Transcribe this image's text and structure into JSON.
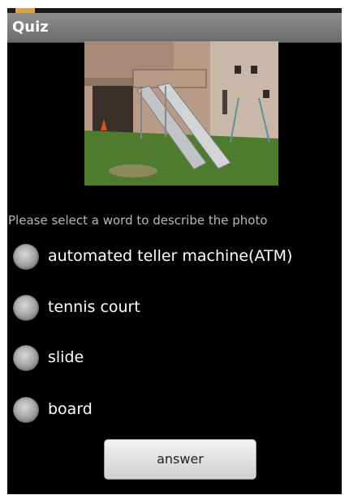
{
  "app": {
    "title": "Quiz"
  },
  "quiz": {
    "prompt": "Please select a word to describe the photo",
    "options": [
      {
        "label": "automated teller machine(ATM)"
      },
      {
        "label": "tennis court"
      },
      {
        "label": "slide"
      },
      {
        "label": "board"
      }
    ],
    "answer_label": "answer"
  },
  "colors": {
    "background": "#000000",
    "titlebar": "#7d7d7d",
    "prompt_text": "#b8b8b8",
    "option_text": "#ffffff"
  }
}
